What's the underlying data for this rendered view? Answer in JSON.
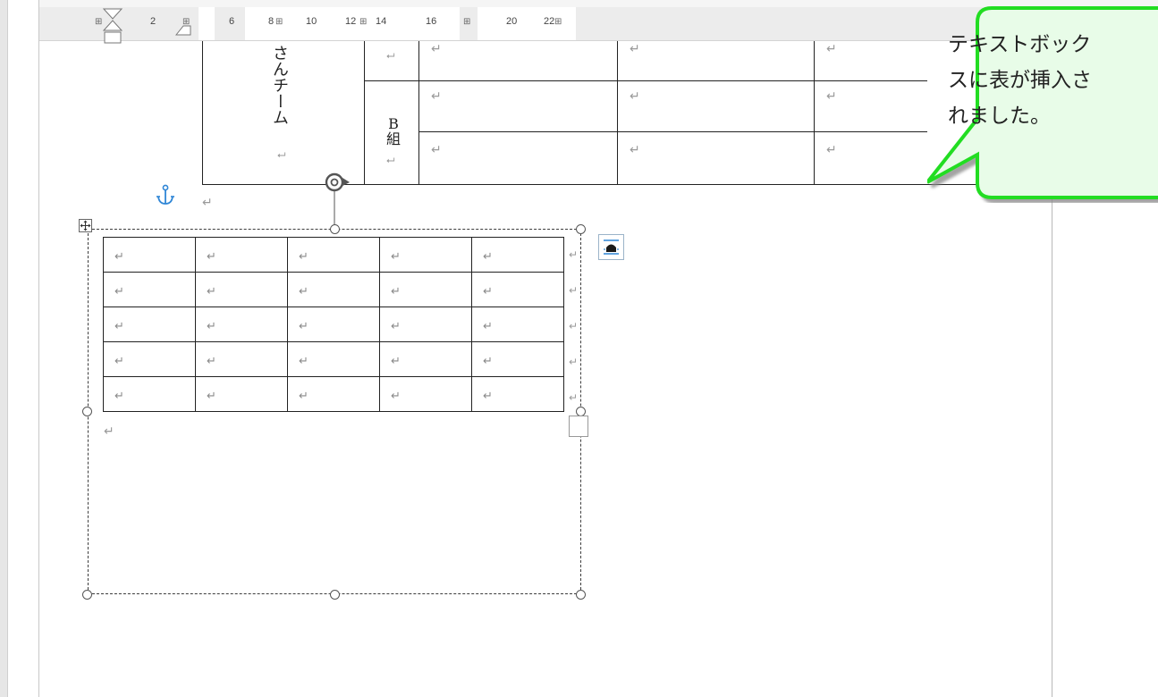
{
  "ruler": {
    "numbers": [
      "2",
      "6",
      "8",
      "10",
      "12",
      "14",
      "16",
      "20",
      "22"
    ]
  },
  "upper_table": {
    "team_label": "さんチーム",
    "group_label_b": "B",
    "group_label_kumi": "組",
    "cell_mark": "⮠",
    "paragraph_mark": "↵"
  },
  "inserted_table": {
    "rows": 5,
    "cols": 5,
    "cell_mark": "↵",
    "end_mark": "↵"
  },
  "callout": {
    "text_line1": "テキストボック",
    "text_line2": "スに表が挿入さ",
    "text_line3": "れました。",
    "fill_color": "#e8fce8",
    "border_color": "#22dd22"
  },
  "icons": {
    "anchor": "anchor-icon",
    "rotate": "rotate-handle-icon",
    "move": "table-move-handle-icon",
    "layout": "layout-options-icon"
  }
}
